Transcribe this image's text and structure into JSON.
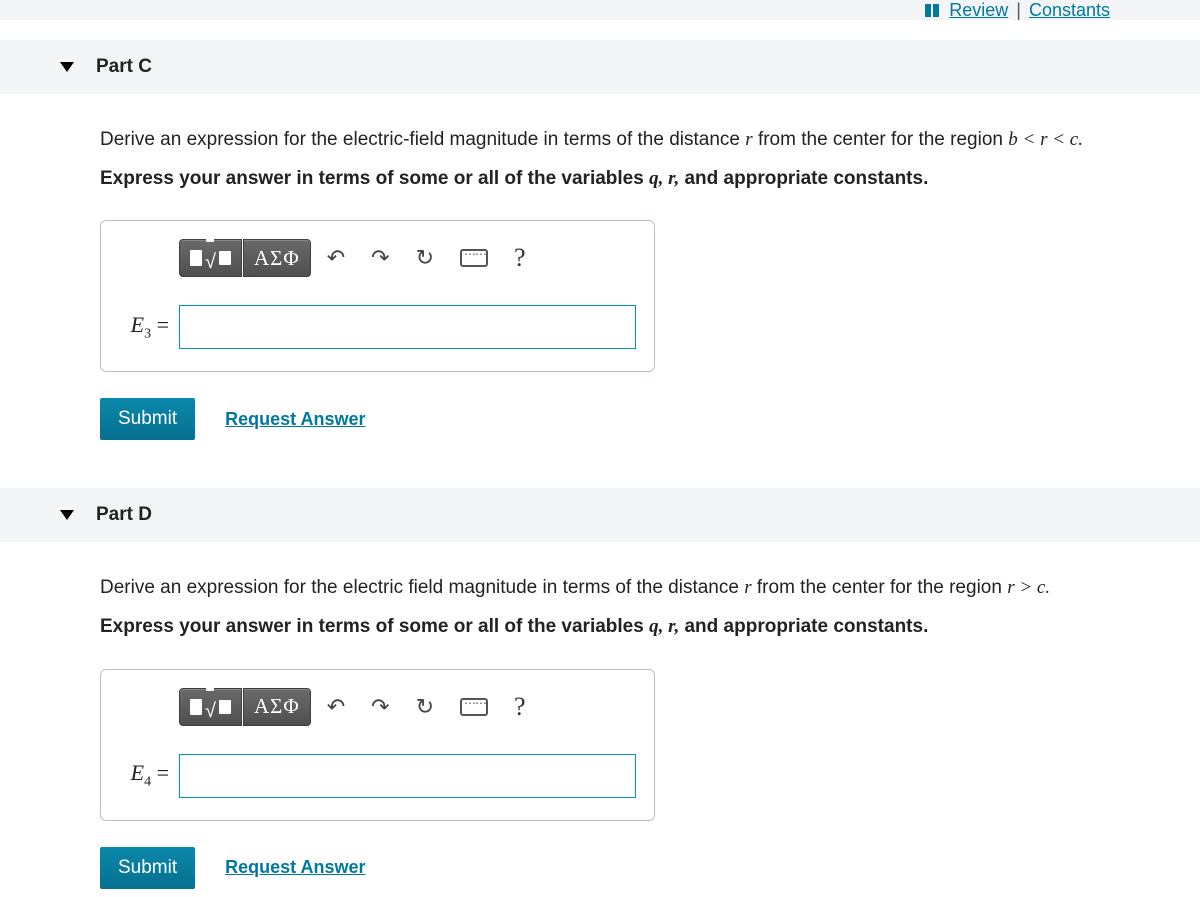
{
  "top": {
    "review": "Review",
    "constants": "Constants"
  },
  "parts": {
    "c": {
      "title": "Part C",
      "prompt_pre": "Derive an expression for the electric-field magnitude in terms of the distance ",
      "prompt_r": "r",
      "prompt_mid": " from the center for the region ",
      "prompt_region": "b < r < c.",
      "instruction_pre": "Express your answer in terms of some or all of the variables ",
      "instruction_vars": "q, r,",
      "instruction_post": " and appropriate constants.",
      "toolbar": {
        "templates_label": "templates",
        "symbols_label": "ΑΣΦ",
        "undo": "↶",
        "redo": "↷",
        "reset": "↻",
        "keyboard": "keyboard",
        "help": "?"
      },
      "answer_label_var": "E",
      "answer_label_sub": "3",
      "answer_label_eq": " =",
      "submit": "Submit",
      "request": "Request Answer"
    },
    "d": {
      "title": "Part D",
      "prompt_pre": "Derive an expression for the electric field magnitude in terms of the distance ",
      "prompt_r": "r",
      "prompt_mid": " from the center for the region ",
      "prompt_region": "r > c.",
      "instruction_pre": "Express your answer in terms of some or all of the variables ",
      "instruction_vars": "q, r,",
      "instruction_post": " and appropriate constants.",
      "toolbar": {
        "templates_label": "templates",
        "symbols_label": "ΑΣΦ",
        "undo": "↶",
        "redo": "↷",
        "reset": "↻",
        "keyboard": "keyboard",
        "help": "?"
      },
      "answer_label_var": "E",
      "answer_label_sub": "4",
      "answer_label_eq": " =",
      "submit": "Submit",
      "request": "Request Answer"
    }
  }
}
